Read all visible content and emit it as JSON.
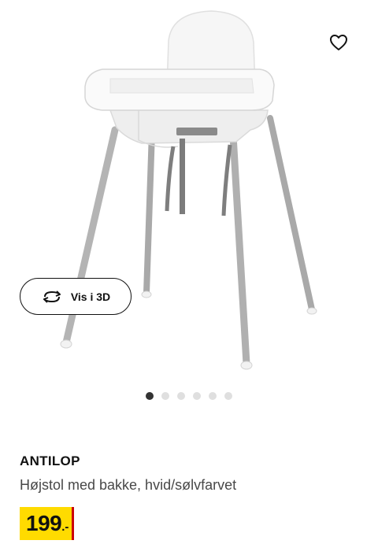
{
  "gallery": {
    "view_3d_label": "Vis i 3D",
    "dot_count": 6,
    "active_index": 0
  },
  "product": {
    "name": "ANTILOP",
    "description": "Højstol med bakke, hvid/sølvfarvet",
    "price_integer": "199",
    "price_suffix": ".-"
  },
  "icons": {
    "favorite": "heart-icon",
    "view_3d": "rotate-3d-icon"
  },
  "colors": {
    "price_bg": "#ffdb00",
    "price_accent": "#cc0008",
    "text_primary": "#111111",
    "text_secondary": "#484848"
  }
}
